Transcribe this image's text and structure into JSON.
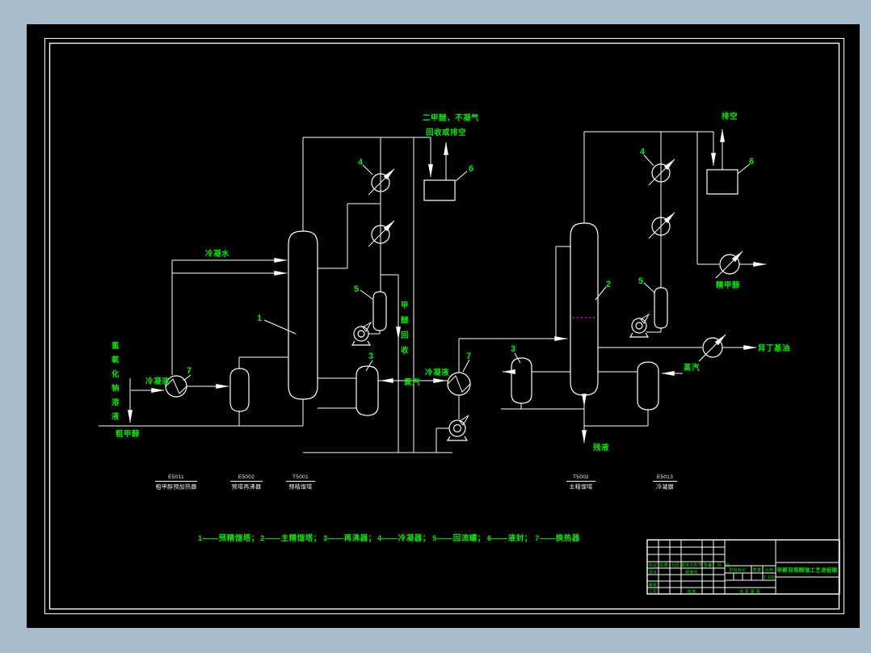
{
  "page": {
    "background": "#a8bccb",
    "canvas": "#000000",
    "line_color": "#ffffff",
    "text_color": "#00e800",
    "dashed_color": "#dd00dd"
  },
  "streams": {
    "dme_line1": "二甲醚，不凝气",
    "dme_line2": "回收或排空",
    "vent": "排空",
    "cooling_water": "冷凝水",
    "condensate_left": "冷凝液",
    "condensate_mid": "冷凝液",
    "steam_mid": "蒸汽",
    "steam_right": "蒸汽",
    "naoh": "氢氧化钠溶液",
    "crude_methanol": "粗甲醇",
    "dme_recovery": "甲醚回收",
    "refined_methanol": "精甲醇",
    "isobutyl_oil": "异丁基油",
    "residue": "残液"
  },
  "nums": {
    "n1": "1",
    "n2": "2",
    "n3": "3",
    "n4": "4",
    "n5": "5",
    "n6": "6",
    "n7": "7"
  },
  "equipment_labels": [
    {
      "tag": "E5011",
      "name": "粗甲醇预加热器"
    },
    {
      "tag": "E5002",
      "name": "预塔再沸器"
    },
    {
      "tag": "T5001",
      "name": "预精馏塔"
    },
    {
      "tag": "T5002",
      "name": "主精馏塔"
    },
    {
      "tag": "E5013",
      "name": "冷凝器"
    }
  ],
  "legend": [
    "1——预精馏塔；",
    "2——主精馏塔；",
    "3——再沸器；",
    "4——冷凝器；",
    "5——回流罐；",
    "6——液封；",
    "7——换热器"
  ],
  "title_block": {
    "title": "甲醇双塔精馏工艺流程图",
    "header": [
      "标记",
      "处数",
      "分区",
      "更改文件号",
      "签名",
      "年、月、日"
    ],
    "design": "设计",
    "standard": "标准化",
    "audit": "审核",
    "process": "工艺",
    "approve": "批准",
    "stage": "阶段标记",
    "mass": "质量",
    "scale_label": "比例",
    "scale_value": "1:100",
    "sheet": "共 张 第 张"
  }
}
